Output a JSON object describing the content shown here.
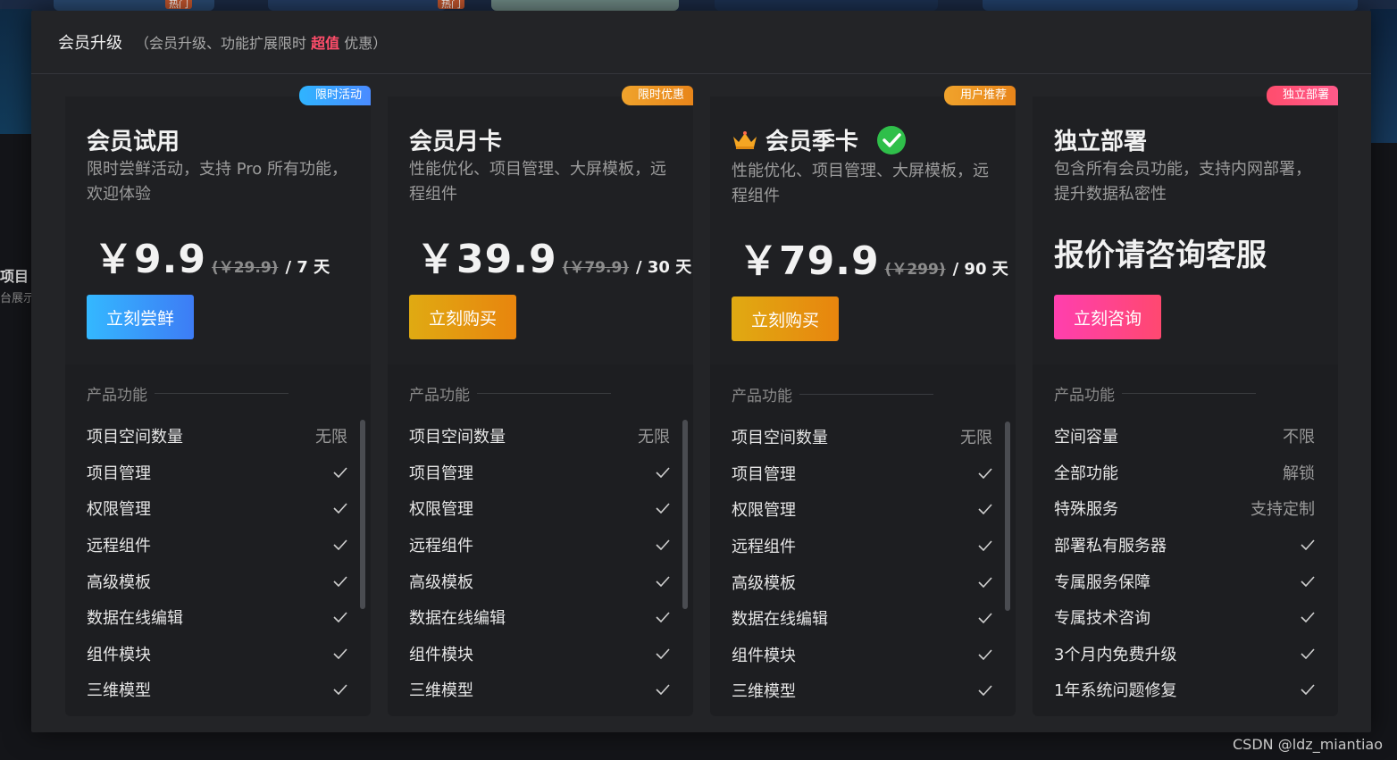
{
  "background": {
    "hot_labels": [
      "热门",
      "热门"
    ],
    "side_title": "项目",
    "side_sub": "台展示"
  },
  "modal": {
    "title": "会员升级",
    "subtitle_prefix": "（会员升级、功能扩展限时 ",
    "subtitle_highlight": "超值",
    "subtitle_suffix": " 优惠）"
  },
  "plans": [
    {
      "ribbon": "限时活动",
      "ribbon_colors": [
        "#2fb4ff",
        "#4a8bff"
      ],
      "title": "会员试用",
      "desc": "限时尝鲜活动，支持 Pro 所有功能，欢迎体验",
      "price": "￥9.9",
      "old_price": "(￥29.9)",
      "period": "/ 7 天",
      "cta": "立刻尝鲜",
      "cta_colors": [
        "#34b8ff",
        "#3d7cf5"
      ],
      "features_heading": "产品功能",
      "features": [
        {
          "name": "项目空间数量",
          "value": "无限"
        },
        {
          "name": "项目管理",
          "icon": "check-icon"
        },
        {
          "name": "权限管理",
          "icon": "check-icon"
        },
        {
          "name": "远程组件",
          "icon": "check-icon"
        },
        {
          "name": "高级模板",
          "icon": "check-icon"
        },
        {
          "name": "数据在线编辑",
          "icon": "check-icon"
        },
        {
          "name": "组件模块",
          "icon": "check-icon"
        },
        {
          "name": "三维模型",
          "icon": "check-icon"
        }
      ]
    },
    {
      "ribbon": "限时优惠",
      "ribbon_colors": [
        "#f0a32c",
        "#e8851a"
      ],
      "title": "会员月卡",
      "desc": "性能优化、项目管理、大屏模板，远程组件",
      "price": "￥39.9",
      "old_price": "(￥79.9)",
      "period": "/ 30 天",
      "cta": "立刻购买",
      "cta_colors": [
        "#e0aa12",
        "#e8850e"
      ],
      "features_heading": "产品功能",
      "features": [
        {
          "name": "项目空间数量",
          "value": "无限"
        },
        {
          "name": "项目管理",
          "icon": "check-icon"
        },
        {
          "name": "权限管理",
          "icon": "check-icon"
        },
        {
          "name": "远程组件",
          "icon": "check-icon"
        },
        {
          "name": "高级模板",
          "icon": "check-icon"
        },
        {
          "name": "数据在线编辑",
          "icon": "check-icon"
        },
        {
          "name": "组件模块",
          "icon": "check-icon"
        },
        {
          "name": "三维模型",
          "icon": "check-icon"
        }
      ]
    },
    {
      "ribbon": "用户推荐",
      "ribbon_colors": [
        "#f0a32c",
        "#e8851a"
      ],
      "title": "会员季卡",
      "title_icons": [
        "crown-icon",
        "check-circle-icon"
      ],
      "desc": "性能优化、项目管理、大屏模板，远程组件",
      "price": "￥79.9",
      "old_price": "(￥299)",
      "period": "/ 90 天",
      "cta": "立刻购买",
      "cta_colors": [
        "#e0aa12",
        "#e8850e"
      ],
      "features_heading": "产品功能",
      "features": [
        {
          "name": "项目空间数量",
          "value": "无限"
        },
        {
          "name": "项目管理",
          "icon": "check-icon"
        },
        {
          "name": "权限管理",
          "icon": "check-icon"
        },
        {
          "name": "远程组件",
          "icon": "check-icon"
        },
        {
          "name": "高级模板",
          "icon": "check-icon"
        },
        {
          "name": "数据在线编辑",
          "icon": "check-icon"
        },
        {
          "name": "组件模块",
          "icon": "check-icon"
        },
        {
          "name": "三维模型",
          "icon": "check-icon"
        }
      ]
    },
    {
      "ribbon": "独立部署",
      "ribbon_colors": [
        "#ff4d6d",
        "#ff5a8a"
      ],
      "title": "独立部署",
      "desc": "包含所有会员功能，支持内网部署，提升数据私密性",
      "quote": "报价请咨询客服",
      "cta": "立刻咨询",
      "cta_colors": [
        "#ff3fae",
        "#ff4870"
      ],
      "features_heading": "产品功能",
      "features": [
        {
          "name": "空间容量",
          "value": "不限"
        },
        {
          "name": "全部功能",
          "value": "解锁"
        },
        {
          "name": "特殊服务",
          "value": "支持定制"
        },
        {
          "name": "部署私有服务器",
          "icon": "check-icon"
        },
        {
          "name": "专属服务保障",
          "icon": "check-icon"
        },
        {
          "name": "专属技术咨询",
          "icon": "check-icon"
        },
        {
          "name": "3个月内免费升级",
          "icon": "check-icon"
        },
        {
          "name": "1年系统问题修复",
          "icon": "check-icon"
        }
      ]
    }
  ],
  "watermark": "CSDN @ldz_miantiao"
}
